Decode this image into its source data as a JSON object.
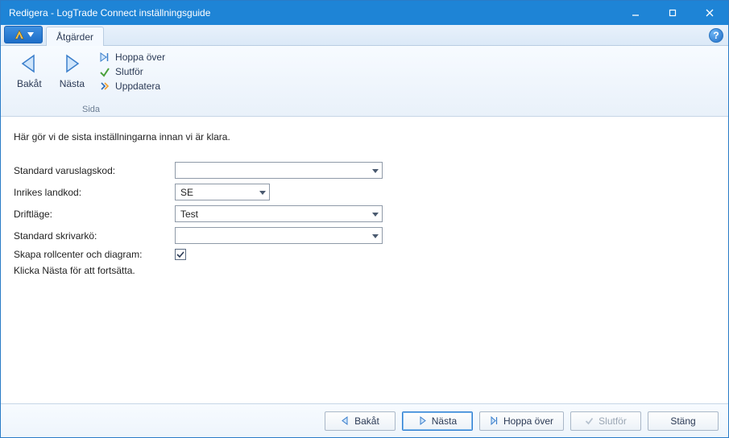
{
  "window": {
    "title": "Redigera - LogTrade Connect inställningsguide"
  },
  "tabs": {
    "actions": "Åtgärder"
  },
  "ribbon": {
    "back": "Bakåt",
    "next": "Nästa",
    "skip": "Hoppa över",
    "finish": "Slutför",
    "refresh": "Uppdatera",
    "group_page": "Sida"
  },
  "content": {
    "intro": "Här gör vi de sista inställningarna innan vi är klara.",
    "fields": {
      "warehouse_label": "Standard varuslagskod:",
      "warehouse_value": "",
      "domestic_country_label": "Inrikes landkod:",
      "domestic_country_value": "SE",
      "mode_label": "Driftläge:",
      "mode_value": "Test",
      "printer_queue_label": "Standard skrivarkö:",
      "printer_queue_value": "",
      "rolecenter_label": "Skapa rollcenter och diagram:",
      "rolecenter_checked": true
    },
    "footer_note": "Klicka Nästa för att fortsätta."
  },
  "footer": {
    "back": "Bakåt",
    "next": "Nästa",
    "skip": "Hoppa över",
    "finish": "Slutför",
    "close": "Stäng"
  },
  "help_symbol": "?"
}
